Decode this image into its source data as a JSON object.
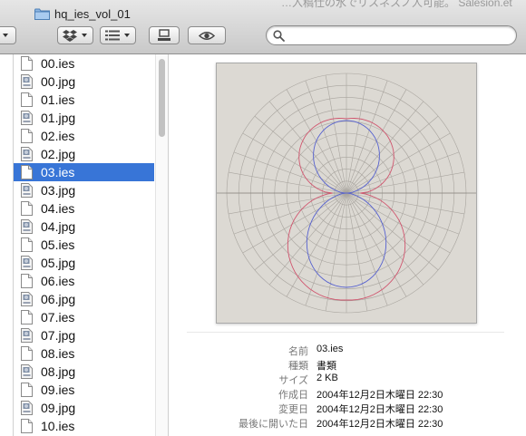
{
  "window": {
    "title": "hq_ies_vol_01",
    "background_text": "…入稿仕の水でリスネスノ人可能。 Salesion.et"
  },
  "toolbar": {
    "search_placeholder": "",
    "search_value": ""
  },
  "files": [
    {
      "name": "00.ies",
      "type": "ies"
    },
    {
      "name": "00.jpg",
      "type": "jpg"
    },
    {
      "name": "01.ies",
      "type": "ies"
    },
    {
      "name": "01.jpg",
      "type": "jpg"
    },
    {
      "name": "02.ies",
      "type": "ies"
    },
    {
      "name": "02.jpg",
      "type": "jpg"
    },
    {
      "name": "03.ies",
      "type": "ies",
      "selected": true
    },
    {
      "name": "03.jpg",
      "type": "jpg"
    },
    {
      "name": "04.ies",
      "type": "ies"
    },
    {
      "name": "04.jpg",
      "type": "jpg"
    },
    {
      "name": "05.ies",
      "type": "ies"
    },
    {
      "name": "05.jpg",
      "type": "jpg"
    },
    {
      "name": "06.ies",
      "type": "ies"
    },
    {
      "name": "06.jpg",
      "type": "jpg"
    },
    {
      "name": "07.ies",
      "type": "ies"
    },
    {
      "name": "07.jpg",
      "type": "jpg"
    },
    {
      "name": "08.ies",
      "type": "ies"
    },
    {
      "name": "08.jpg",
      "type": "jpg"
    },
    {
      "name": "09.ies",
      "type": "ies"
    },
    {
      "name": "09.jpg",
      "type": "jpg"
    },
    {
      "name": "10.ies",
      "type": "ies"
    }
  ],
  "info": [
    {
      "label": "名前",
      "value": "03.ies"
    },
    {
      "label": "種類",
      "value": "書類"
    },
    {
      "label": "サイズ",
      "value": "2 KB"
    },
    {
      "label": "作成日",
      "value": "2004年12月2日木曜日 22:30"
    },
    {
      "label": "変更日",
      "value": "2004年12月2日木曜日 22:30"
    },
    {
      "label": "最後に開いた日",
      "value": "2004年12月2日木曜日 22:30"
    }
  ],
  "colors": {
    "selection": "#3875d7",
    "preview_background": "#dcd9d3",
    "grid_line": "#a8a49e",
    "curve_red": "#d0556e",
    "curve_blue": "#5560cf"
  },
  "icons": {
    "title": "folder-icon",
    "view_menu": "list-view-icon",
    "dropbox": "dropbox-icon",
    "arrange": "arrange-icon",
    "action": "share-icon",
    "quicklook": "eye-icon",
    "search": "magnifier-icon"
  }
}
